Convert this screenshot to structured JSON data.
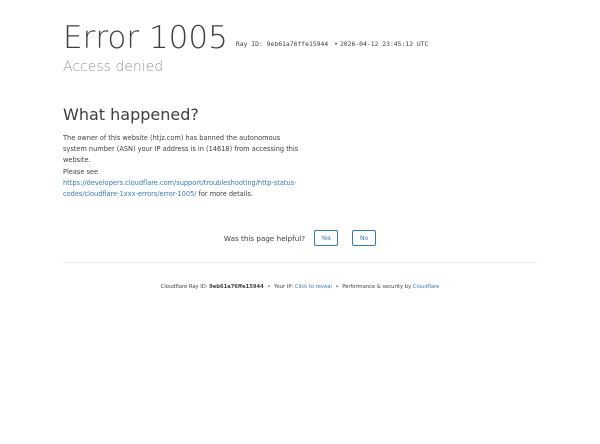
{
  "header": {
    "error_title": "Error 1005",
    "ray_label": "Ray ID:",
    "ray_id": "9eb61a76ffe15944",
    "bullet": "•",
    "timestamp": "2026-04-12 23:45:12 UTC",
    "subtitle": "Access denied"
  },
  "section": {
    "title": "What happened?",
    "line1": "The owner of this website (htjz.com) has banned the autonomous system number (ASN) your IP address is in (14618) from accessing this website.",
    "please_see": "Please see",
    "doc_link": "https://developers.cloudflare.com/support/troubleshooting/http-status-codes/cloudflare-1xxx-errors/error-1005/",
    "more_details": " for more details."
  },
  "feedback": {
    "question": "Was this page helpful?",
    "yes_label": "Yes",
    "no_label": "No"
  },
  "footer": {
    "ray_prefix": "Cloudflare Ray ID: ",
    "ray_id": "9eb61a76ffe15944",
    "sep": "•",
    "ip_prefix": "Your IP: ",
    "ip_link": "Click to reveal",
    "perf_text": "Performance & security by ",
    "cf_link": "Cloudflare"
  },
  "colors": {
    "text": "#404040",
    "muted": "#999999",
    "link": "#2f7bbf"
  }
}
